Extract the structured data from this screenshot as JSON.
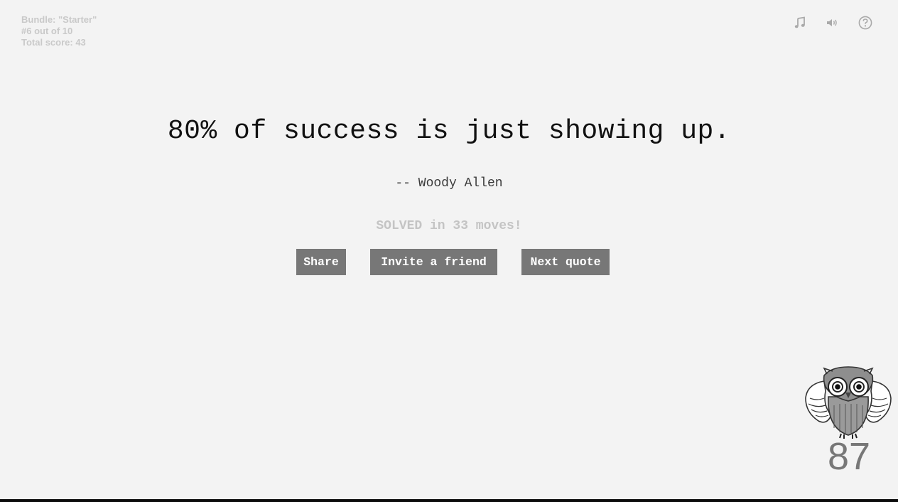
{
  "info": {
    "bundle": "Bundle: \"Starter\"",
    "progress": "#6 out of 10",
    "score": "Total score: 43"
  },
  "icons": {
    "music": "music-note-icon",
    "sound": "speaker-icon",
    "help": "help-icon"
  },
  "quote": {
    "text": "80% of success is just showing up.",
    "author": "-- Woody Allen"
  },
  "status": "SOLVED in 33 moves!",
  "buttons": {
    "share": "Share",
    "invite": "Invite a friend",
    "next": "Next quote"
  },
  "counter": "87",
  "colors": {
    "background": "#f3f3f3",
    "button": "#777777",
    "info_text": "#c9c9c9",
    "status_text": "#c4c4c4",
    "bottom_bar": "#0c0c0c"
  }
}
